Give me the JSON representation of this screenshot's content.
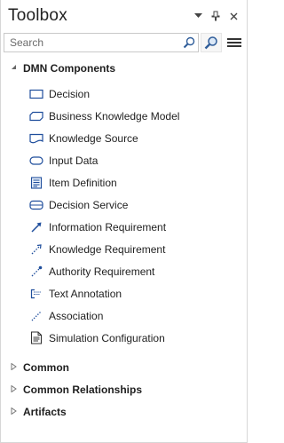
{
  "window": {
    "title": "Toolbox"
  },
  "search": {
    "placeholder": "Search",
    "value": ""
  },
  "groups": [
    {
      "label": "DMN Components",
      "expanded": true,
      "items": [
        {
          "label": "Decision",
          "icon": "decision-rect-icon"
        },
        {
          "label": "Business Knowledge Model",
          "icon": "bkm-icon"
        },
        {
          "label": "Knowledge Source",
          "icon": "knowledge-source-icon"
        },
        {
          "label": "Input Data",
          "icon": "input-data-icon"
        },
        {
          "label": "Item Definition",
          "icon": "item-definition-icon"
        },
        {
          "label": "Decision Service",
          "icon": "decision-service-icon"
        },
        {
          "label": "Information Requirement",
          "icon": "information-requirement-icon"
        },
        {
          "label": "Knowledge Requirement",
          "icon": "knowledge-requirement-icon"
        },
        {
          "label": "Authority Requirement",
          "icon": "authority-requirement-icon"
        },
        {
          "label": "Text Annotation",
          "icon": "text-annotation-icon"
        },
        {
          "label": "Association",
          "icon": "association-icon"
        },
        {
          "label": "Simulation Configuration",
          "icon": "simulation-configuration-icon"
        }
      ]
    },
    {
      "label": "Common",
      "expanded": false,
      "items": []
    },
    {
      "label": "Common Relationships",
      "expanded": false,
      "items": []
    },
    {
      "label": "Artifacts",
      "expanded": false,
      "items": []
    }
  ],
  "colors": {
    "icon_blue": "#1f4e9c",
    "accent": "#3c6fb4"
  }
}
